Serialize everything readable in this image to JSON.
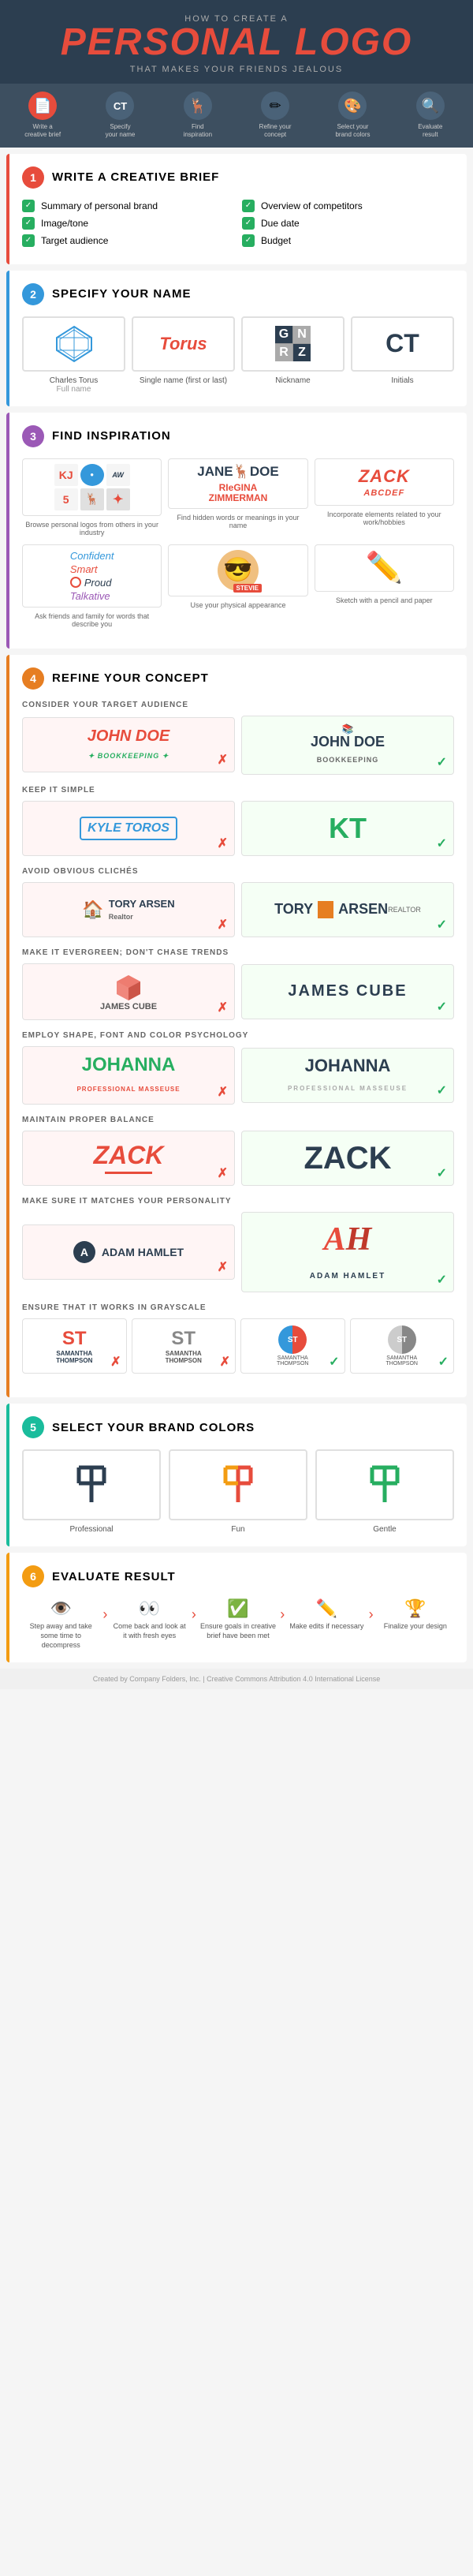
{
  "header": {
    "how_to": "HOW TO CREATE A",
    "title": "PERSONAL LOGO",
    "subtitle": "THAT MAKES YOUR FRIENDS JEALOUS"
  },
  "steps": [
    {
      "num": "1",
      "icon": "📄",
      "label": "Write a creative brief"
    },
    {
      "num": "2",
      "icon": "CT",
      "label": "Specify your name"
    },
    {
      "num": "3",
      "icon": "🦌",
      "label": "Find inspiration"
    },
    {
      "num": "4",
      "icon": "✏",
      "label": "Refine your concept"
    },
    {
      "num": "5",
      "icon": "🎨",
      "label": "Select your brand colors"
    },
    {
      "num": "6",
      "icon": "🔍",
      "label": "Evaluate result"
    }
  ],
  "section1": {
    "number": "1",
    "title": "WRITE A CREATIVE BRIEF",
    "items_left": [
      "Summary of personal brand",
      "Image/tone",
      "Target audience"
    ],
    "items_right": [
      "Overview of competitors",
      "Due date",
      "Budget"
    ]
  },
  "section2": {
    "number": "2",
    "title": "SPECIFY YOUR NAME",
    "options": [
      {
        "label": "Full name",
        "example": "Charles Torus"
      },
      {
        "label": "Single name (first or last)",
        "example": "Torus"
      },
      {
        "label": "Nickname",
        "example": "GN/RZ"
      },
      {
        "label": "Initials",
        "example": "CT"
      }
    ]
  },
  "section3": {
    "number": "3",
    "title": "FIND INSPIRATION",
    "grid_items": [
      {
        "label": "Browse personal logos from others in your industry"
      },
      {
        "label": "Find hidden words or meanings in your name"
      },
      {
        "label": "Incorporate elements related to your work/hobbies"
      }
    ],
    "grid2_items": [
      {
        "label": "Ask friends and family for words that describe you"
      },
      {
        "label": "Use your physical appearance"
      },
      {
        "label": "Sketch with a pencil and paper"
      }
    ],
    "words": [
      "Confident",
      "Smart",
      "Proud",
      "Talkative"
    ]
  },
  "section4": {
    "number": "4",
    "title": "REFINE YOUR CONCEPT",
    "subsections": [
      {
        "subtitle": "CONSIDER YOUR TARGET AUDIENCE",
        "bad_label": "JOHN DOE\nBOOKKEEPING",
        "good_label": "JOHN DOE\nBOOKKEEPING"
      },
      {
        "subtitle": "KEEP IT SIMPLE",
        "bad_label": "KYLE TOROS",
        "good_label": "KT"
      },
      {
        "subtitle": "AVOID OBVIOUS CLICHÉS",
        "bad_label": "TORY ARSEN Realtor",
        "good_label": "TORY ARSEN REALTOR"
      },
      {
        "subtitle": "MAKE IT EVERGREEN; DON'T CHASE TRENDS",
        "bad_label": "JAMES CUBE",
        "good_label": "JAMES CUBE"
      },
      {
        "subtitle": "EMPLOY SHAPE, FONT AND COLOR PSYCHOLOGY",
        "bad_label": "JOHANNA PROFESSIONAL MASSEUSE",
        "good_label": "JOHANNA PROFESSIONAL MASSEUSE"
      },
      {
        "subtitle": "MAINTAIN PROPER BALANCE",
        "bad_label": "ZACK",
        "good_label": "ZACK"
      },
      {
        "subtitle": "MAKE SURE IT MATCHES YOUR PERSONALITY",
        "bad_label": "A ADAM HAMLET",
        "good_label": "ADAM HAMLET"
      },
      {
        "subtitle": "ENSURE THAT IT WORKS IN GRAYSCALE",
        "note": "Four boxes comparison"
      }
    ]
  },
  "section5": {
    "number": "5",
    "title": "SELECT YOUR BRAND COLORS",
    "options": [
      {
        "label": "Professional"
      },
      {
        "label": "Fun"
      },
      {
        "label": "Gentle"
      }
    ]
  },
  "section6": {
    "number": "6",
    "title": "EVALUATE RESULT",
    "steps": [
      {
        "icon": "👁",
        "text": "Step away and take some time to decompress"
      },
      {
        "icon": "👀",
        "text": "Come back and look at it with fresh eyes"
      },
      {
        "icon": "✅",
        "text": "Ensure goals in creative brief have been met"
      },
      {
        "icon": "✏",
        "text": "Make edits if necessary"
      },
      {
        "icon": "🏆",
        "text": "Finalize your design"
      }
    ]
  },
  "footer": {
    "text": "Created by Company Folders, Inc. | Creative Commons Attribution 4.0 International License"
  }
}
